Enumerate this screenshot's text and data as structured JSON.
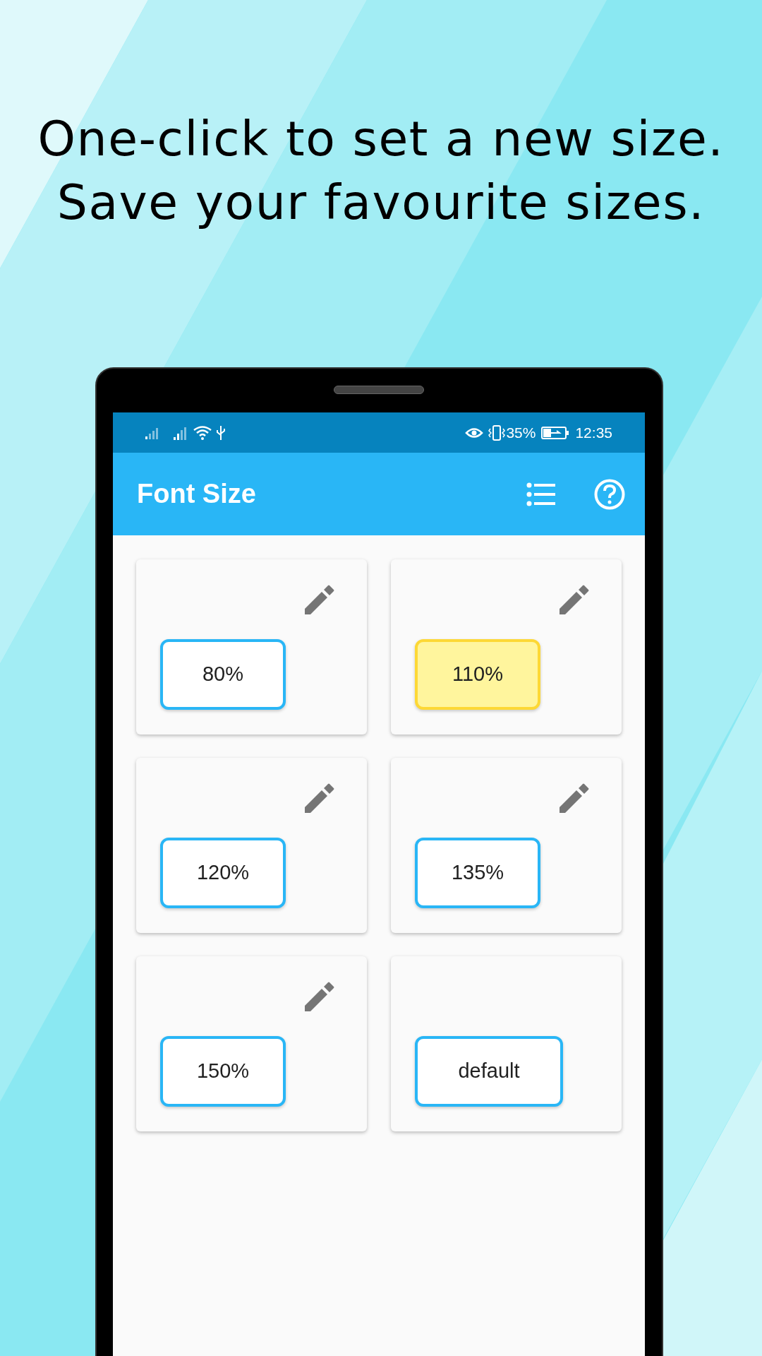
{
  "headline": [
    "One-click to set a new size.",
    "Save your favourite sizes."
  ],
  "status_bar": {
    "battery_percent": "35%",
    "time": "12:35"
  },
  "app_bar": {
    "title": "Font Size"
  },
  "presets": [
    {
      "label": "80%",
      "selected": false,
      "editable": true
    },
    {
      "label": "110%",
      "selected": true,
      "editable": true
    },
    {
      "label": "120%",
      "selected": false,
      "editable": true
    },
    {
      "label": "135%",
      "selected": false,
      "editable": true
    },
    {
      "label": "150%",
      "selected": false,
      "editable": true
    },
    {
      "label": "default",
      "selected": false,
      "editable": false
    }
  ]
}
